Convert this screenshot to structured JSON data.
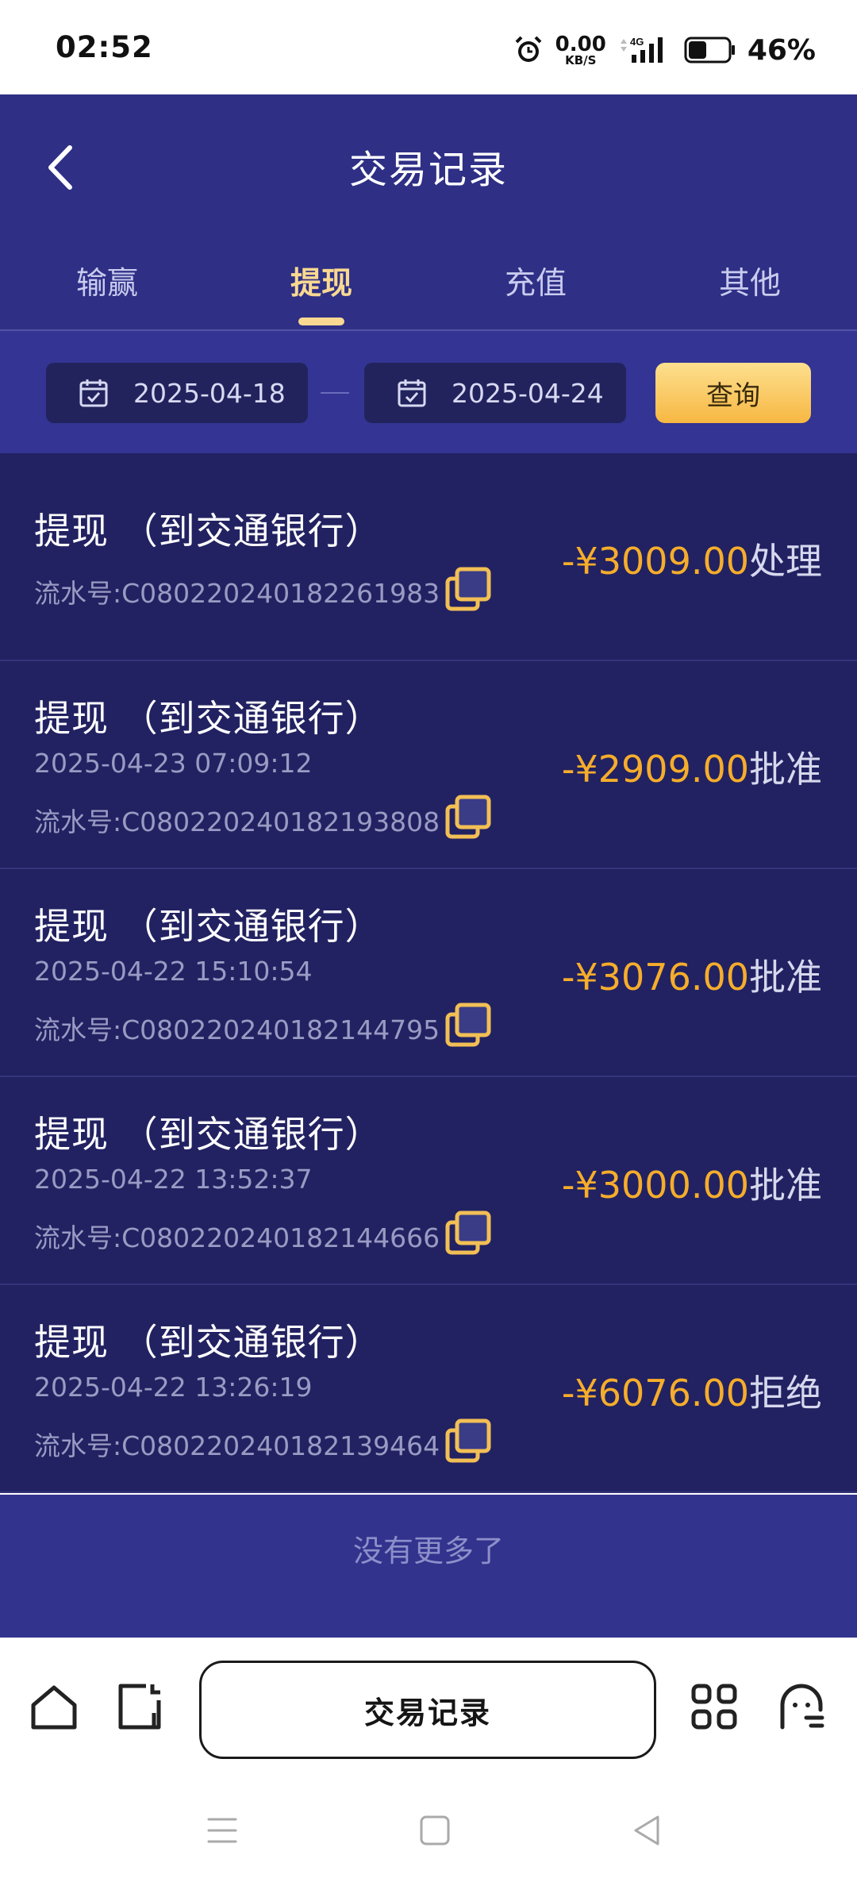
{
  "status_bar": {
    "time": "02:52",
    "net_speed_value": "0.00",
    "net_speed_unit": "KB/S",
    "network": "4G",
    "battery_percent": "46%",
    "battery_level": 0.46,
    "icons": [
      "alarm-icon",
      "signal-icon",
      "battery-icon"
    ]
  },
  "header": {
    "title": "交易记录",
    "back_icon": "chevron-left-icon",
    "tabs": [
      {
        "label": "输赢",
        "active": false
      },
      {
        "label": "提现",
        "active": true
      },
      {
        "label": "充值",
        "active": false
      },
      {
        "label": "其他",
        "active": false
      }
    ]
  },
  "filter": {
    "start_date": "2025-04-18",
    "end_date": "2025-04-24",
    "separator": "—",
    "query_label": "查询",
    "calendar_icon": "calendar-icon"
  },
  "records": [
    {
      "title": "提现 （到交通银行）",
      "date": "",
      "serial": "流水号:C080220240182261983",
      "amount": "-¥3009.00",
      "status": "处理"
    },
    {
      "title": "提现 （到交通银行）",
      "date": "2025-04-23 07:09:12",
      "serial": "流水号:C080220240182193808",
      "amount": "-¥2909.00",
      "status": "批准"
    },
    {
      "title": "提现 （到交通银行）",
      "date": "2025-04-22 15:10:54",
      "serial": "流水号:C080220240182144795",
      "amount": "-¥3076.00",
      "status": "批准"
    },
    {
      "title": "提现 （到交通银行）",
      "date": "2025-04-22 13:52:37",
      "serial": "流水号:C080220240182144666",
      "amount": "-¥3000.00",
      "status": "批准"
    },
    {
      "title": "提现 （到交通银行）",
      "date": "2025-04-22 13:26:19",
      "serial": "流水号:C080220240182139464",
      "amount": "-¥6076.00",
      "status": "拒绝"
    }
  ],
  "no_more_text": "没有更多了",
  "bottom_nav": {
    "active_label": "交易记录",
    "icons": [
      "home-icon",
      "tabs-icon",
      "apps-grid-icon",
      "assistant-icon"
    ]
  },
  "system_nav": {
    "icons": [
      "menu-icon",
      "home-square-icon",
      "back-triangle-icon"
    ]
  },
  "colors": {
    "header_bg": "#2e2f85",
    "filter_bg": "#333493",
    "record_bg": "#222262",
    "accent_gold": "#f9d891",
    "amount_orange": "#f6ad2b"
  }
}
